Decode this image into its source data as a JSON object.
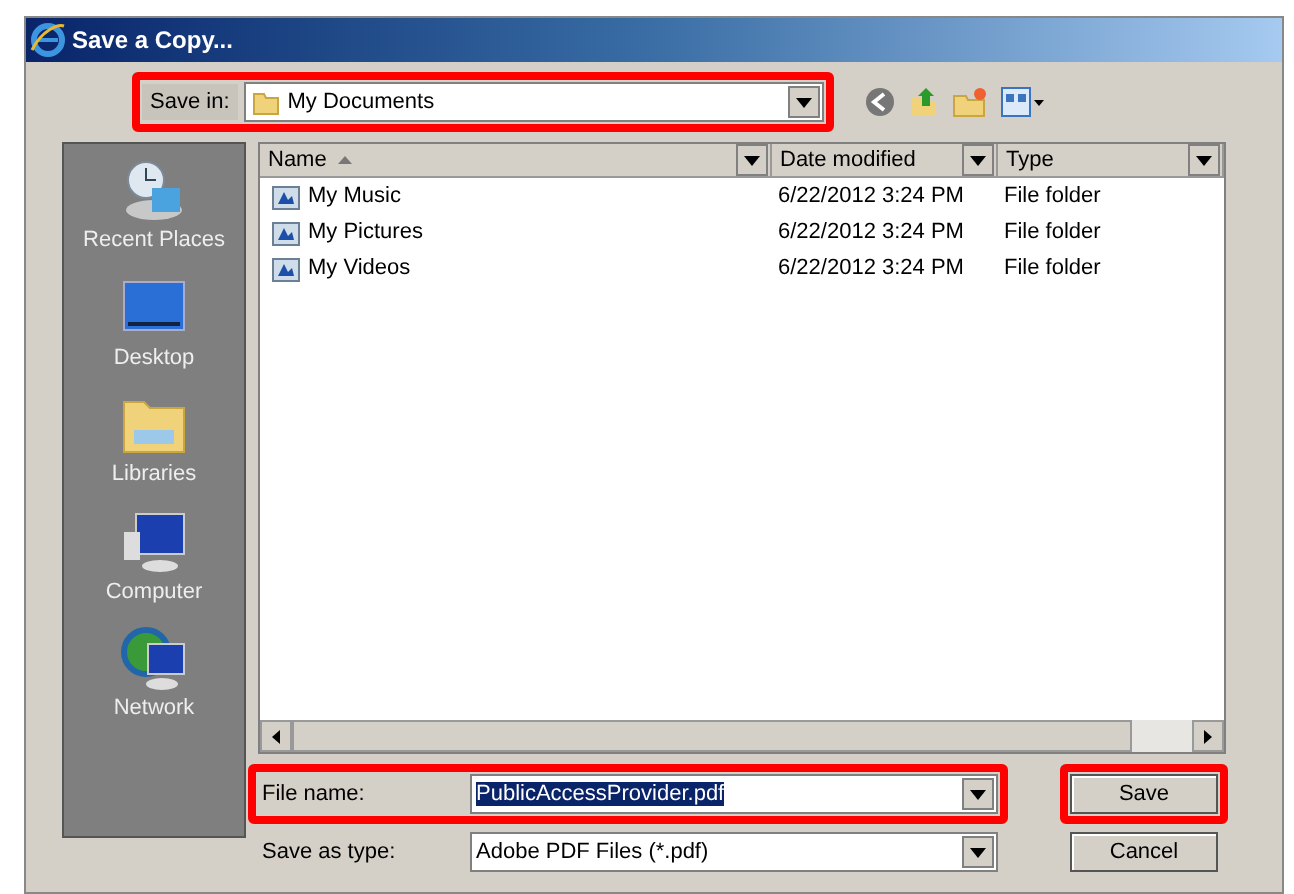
{
  "window": {
    "title": "Save a Copy..."
  },
  "save_in": {
    "label": "Save in:",
    "value": "My Documents",
    "highlighted": true
  },
  "places": [
    {
      "label": "Recent Places",
      "kind": "recent"
    },
    {
      "label": "Desktop",
      "kind": "desktop"
    },
    {
      "label": "Libraries",
      "kind": "libraries"
    },
    {
      "label": "Computer",
      "kind": "computer"
    },
    {
      "label": "Network",
      "kind": "network"
    }
  ],
  "table": {
    "columns": [
      "Name",
      "Date modified",
      "Type"
    ],
    "rows": [
      {
        "name": "My Music",
        "date": "6/22/2012 3:24 PM",
        "type": "File folder"
      },
      {
        "name": "My Pictures",
        "date": "6/22/2012 3:24 PM",
        "type": "File folder"
      },
      {
        "name": "My Videos",
        "date": "6/22/2012 3:24 PM",
        "type": "File folder"
      }
    ]
  },
  "file_name": {
    "label": "File name:",
    "value": "PublicAccessProvider.pdf",
    "highlighted": true
  },
  "save_as_type": {
    "label": "Save as type:",
    "value": "Adobe PDF Files (*.pdf)",
    "highlighted": false
  },
  "buttons": [
    {
      "label": "Save",
      "highlighted": true
    },
    {
      "label": "Cancel",
      "highlighted": false
    }
  ]
}
